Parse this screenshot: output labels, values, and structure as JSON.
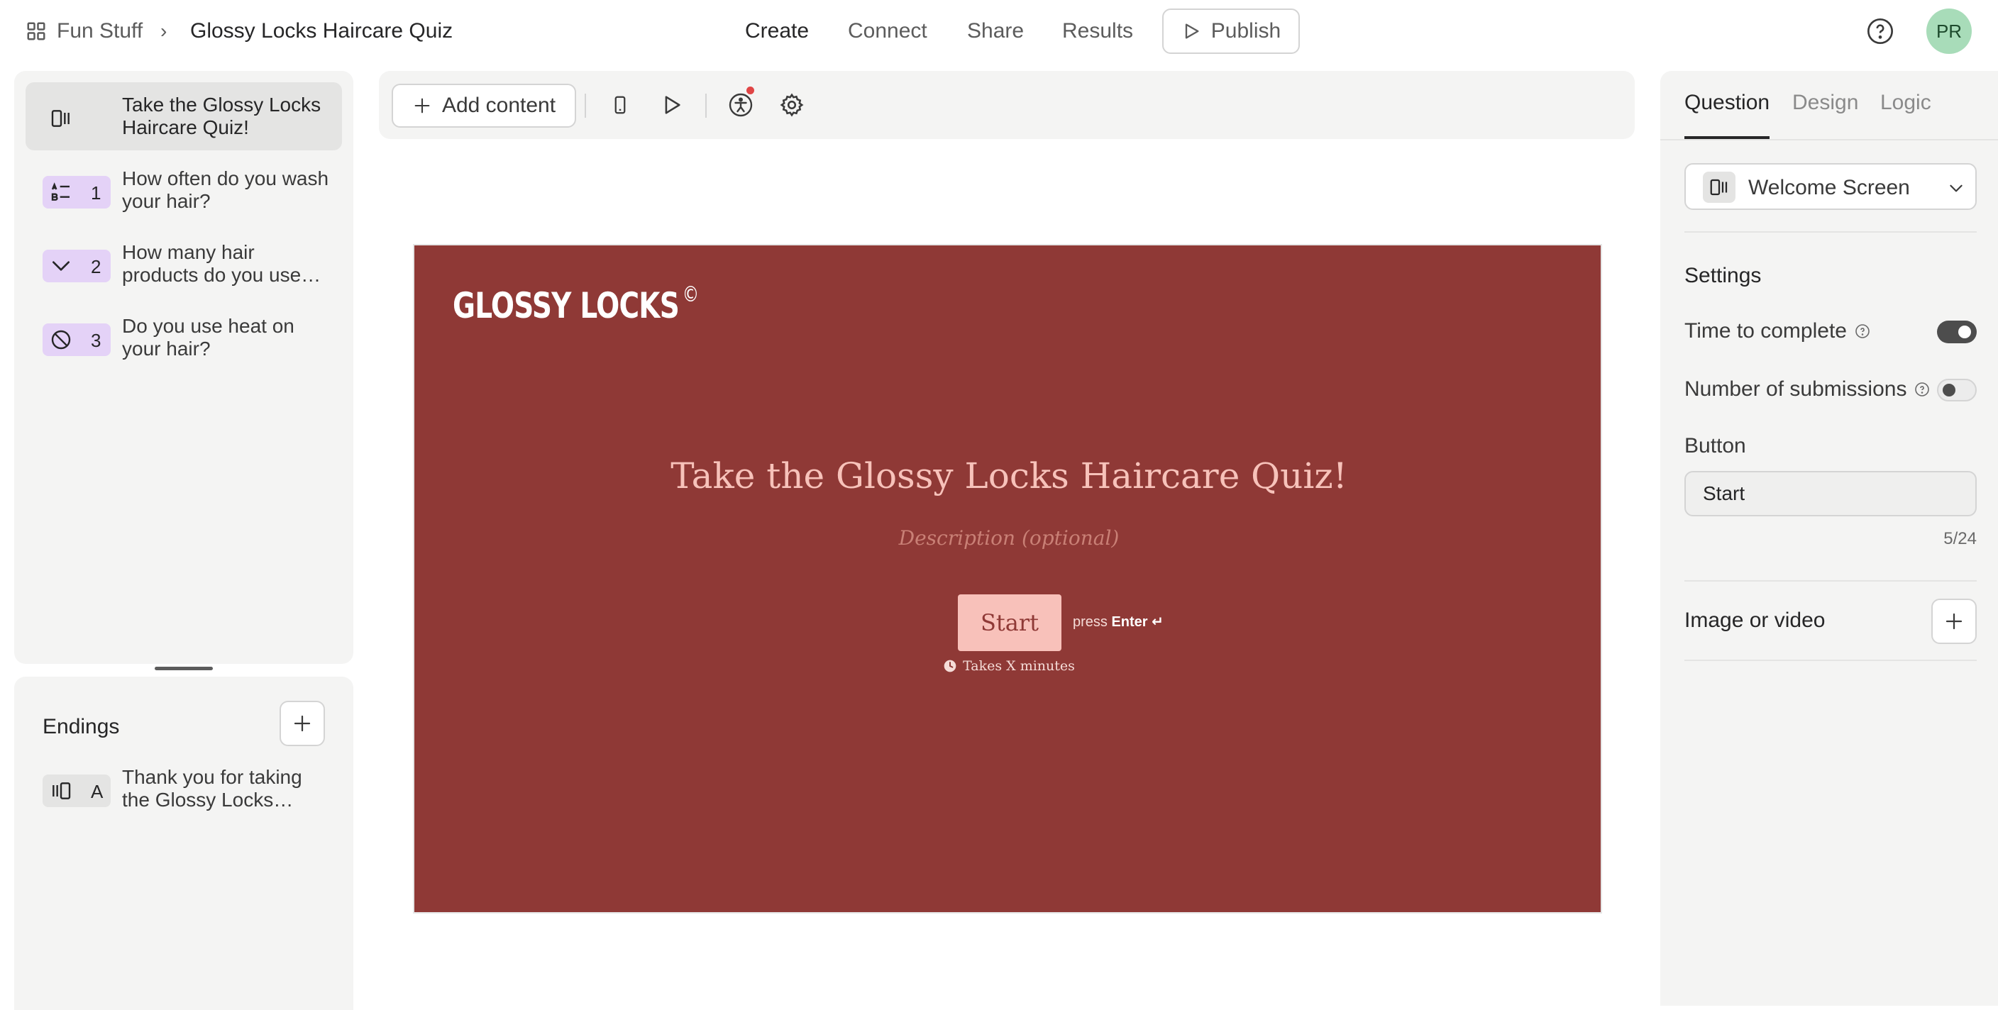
{
  "header": {
    "workspace": "Fun Stuff",
    "separator": "›",
    "form_title": "Glossy Locks Haircare Quiz",
    "nav": [
      "Create",
      "Connect",
      "Share",
      "Results"
    ],
    "publish_label": "Publish",
    "avatar_initials": "PR"
  },
  "questions": [
    {
      "number": "",
      "text": "Take the Glossy Locks Haircare Quiz!",
      "icon": "welcome-screen-icon",
      "badge_color": "#e4e4e3"
    },
    {
      "number": "1",
      "text": "How often do you wash your hair?",
      "icon": "list-icon",
      "badge_color": "#e4d2f7"
    },
    {
      "number": "2",
      "text": "How many hair products do you use…",
      "icon": "dropdown-icon",
      "badge_color": "#e4d2f7"
    },
    {
      "number": "3",
      "text": "Do you use heat on your hair?",
      "icon": "yes-no-icon",
      "badge_color": "#e4d2f7"
    }
  ],
  "endings": {
    "title": "Endings",
    "items": [
      {
        "letter": "A",
        "text": "Thank you for taking the Glossy Locks…",
        "icon": "ending-screen-icon"
      }
    ]
  },
  "toolbar": {
    "add_content_label": "Add content"
  },
  "preview": {
    "logo_text": "GLOSSY LOCKS",
    "logo_mark": "©",
    "title": "Take the Glossy Locks Haircare Quiz!",
    "description_placeholder": "Description (optional)",
    "start_label": "Start",
    "press_text": "press",
    "press_key": "Enter ↵",
    "duration_text": "Takes X minutes",
    "background_color": "#8f3936",
    "title_color": "#f7c2ba",
    "button_color": "#f8c1ba"
  },
  "right_panel": {
    "tabs": [
      "Question",
      "Design",
      "Logic"
    ],
    "type_value": "Welcome Screen",
    "settings_title": "Settings",
    "time_to_complete_label": "Time to complete",
    "time_to_complete_on": true,
    "submissions_label": "Number of submissions",
    "submissions_on": false,
    "button_section_label": "Button",
    "button_value": "Start",
    "char_count": "5/24",
    "media_label": "Image or video"
  }
}
